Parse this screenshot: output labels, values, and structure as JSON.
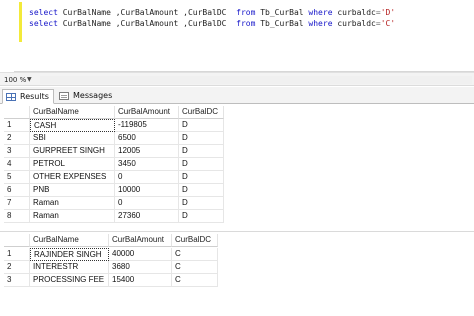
{
  "editor": {
    "line1": {
      "kw1": "select",
      "cols": "CurBalName ,CurBalAmount ,CurBalDC",
      "kw2": "from",
      "table": "Tb_CurBal",
      "kw3": "where",
      "col": "curbaldc",
      "op": "=",
      "val": "'D'"
    },
    "line2": {
      "kw1": "select",
      "cols": "CurBalName ,CurBalAmount ,CurBalDC",
      "kw2": "from",
      "table": "Tb_CurBal",
      "kw3": "where",
      "col": "curbaldc",
      "op": "=",
      "val": "'C'"
    }
  },
  "zoom": {
    "value": "100 %"
  },
  "tabs": {
    "results": "Results",
    "messages": "Messages"
  },
  "grid1": {
    "headers": [
      "CurBalName",
      "CurBalAmount",
      "CurBalDC"
    ],
    "rows": [
      [
        "1",
        "CASH",
        "-119805",
        "D"
      ],
      [
        "2",
        "SBI",
        "6500",
        "D"
      ],
      [
        "3",
        "GURPREET SINGH",
        "12005",
        "D"
      ],
      [
        "4",
        "PETROL",
        "3450",
        "D"
      ],
      [
        "5",
        "OTHER EXPENSES",
        "0",
        "D"
      ],
      [
        "6",
        "PNB",
        "10000",
        "D"
      ],
      [
        "7",
        "Raman",
        "0",
        "D"
      ],
      [
        "8",
        "Raman",
        "27360",
        "D"
      ]
    ]
  },
  "grid2": {
    "headers": [
      "CurBalName",
      "CurBalAmount",
      "CurBalDC"
    ],
    "rows": [
      [
        "1",
        "RAJINDER SINGH",
        "40000",
        "C"
      ],
      [
        "2",
        "INTERESTR",
        "3680",
        "C"
      ],
      [
        "3",
        "PROCESSING FEE",
        "15400",
        "C"
      ]
    ]
  }
}
